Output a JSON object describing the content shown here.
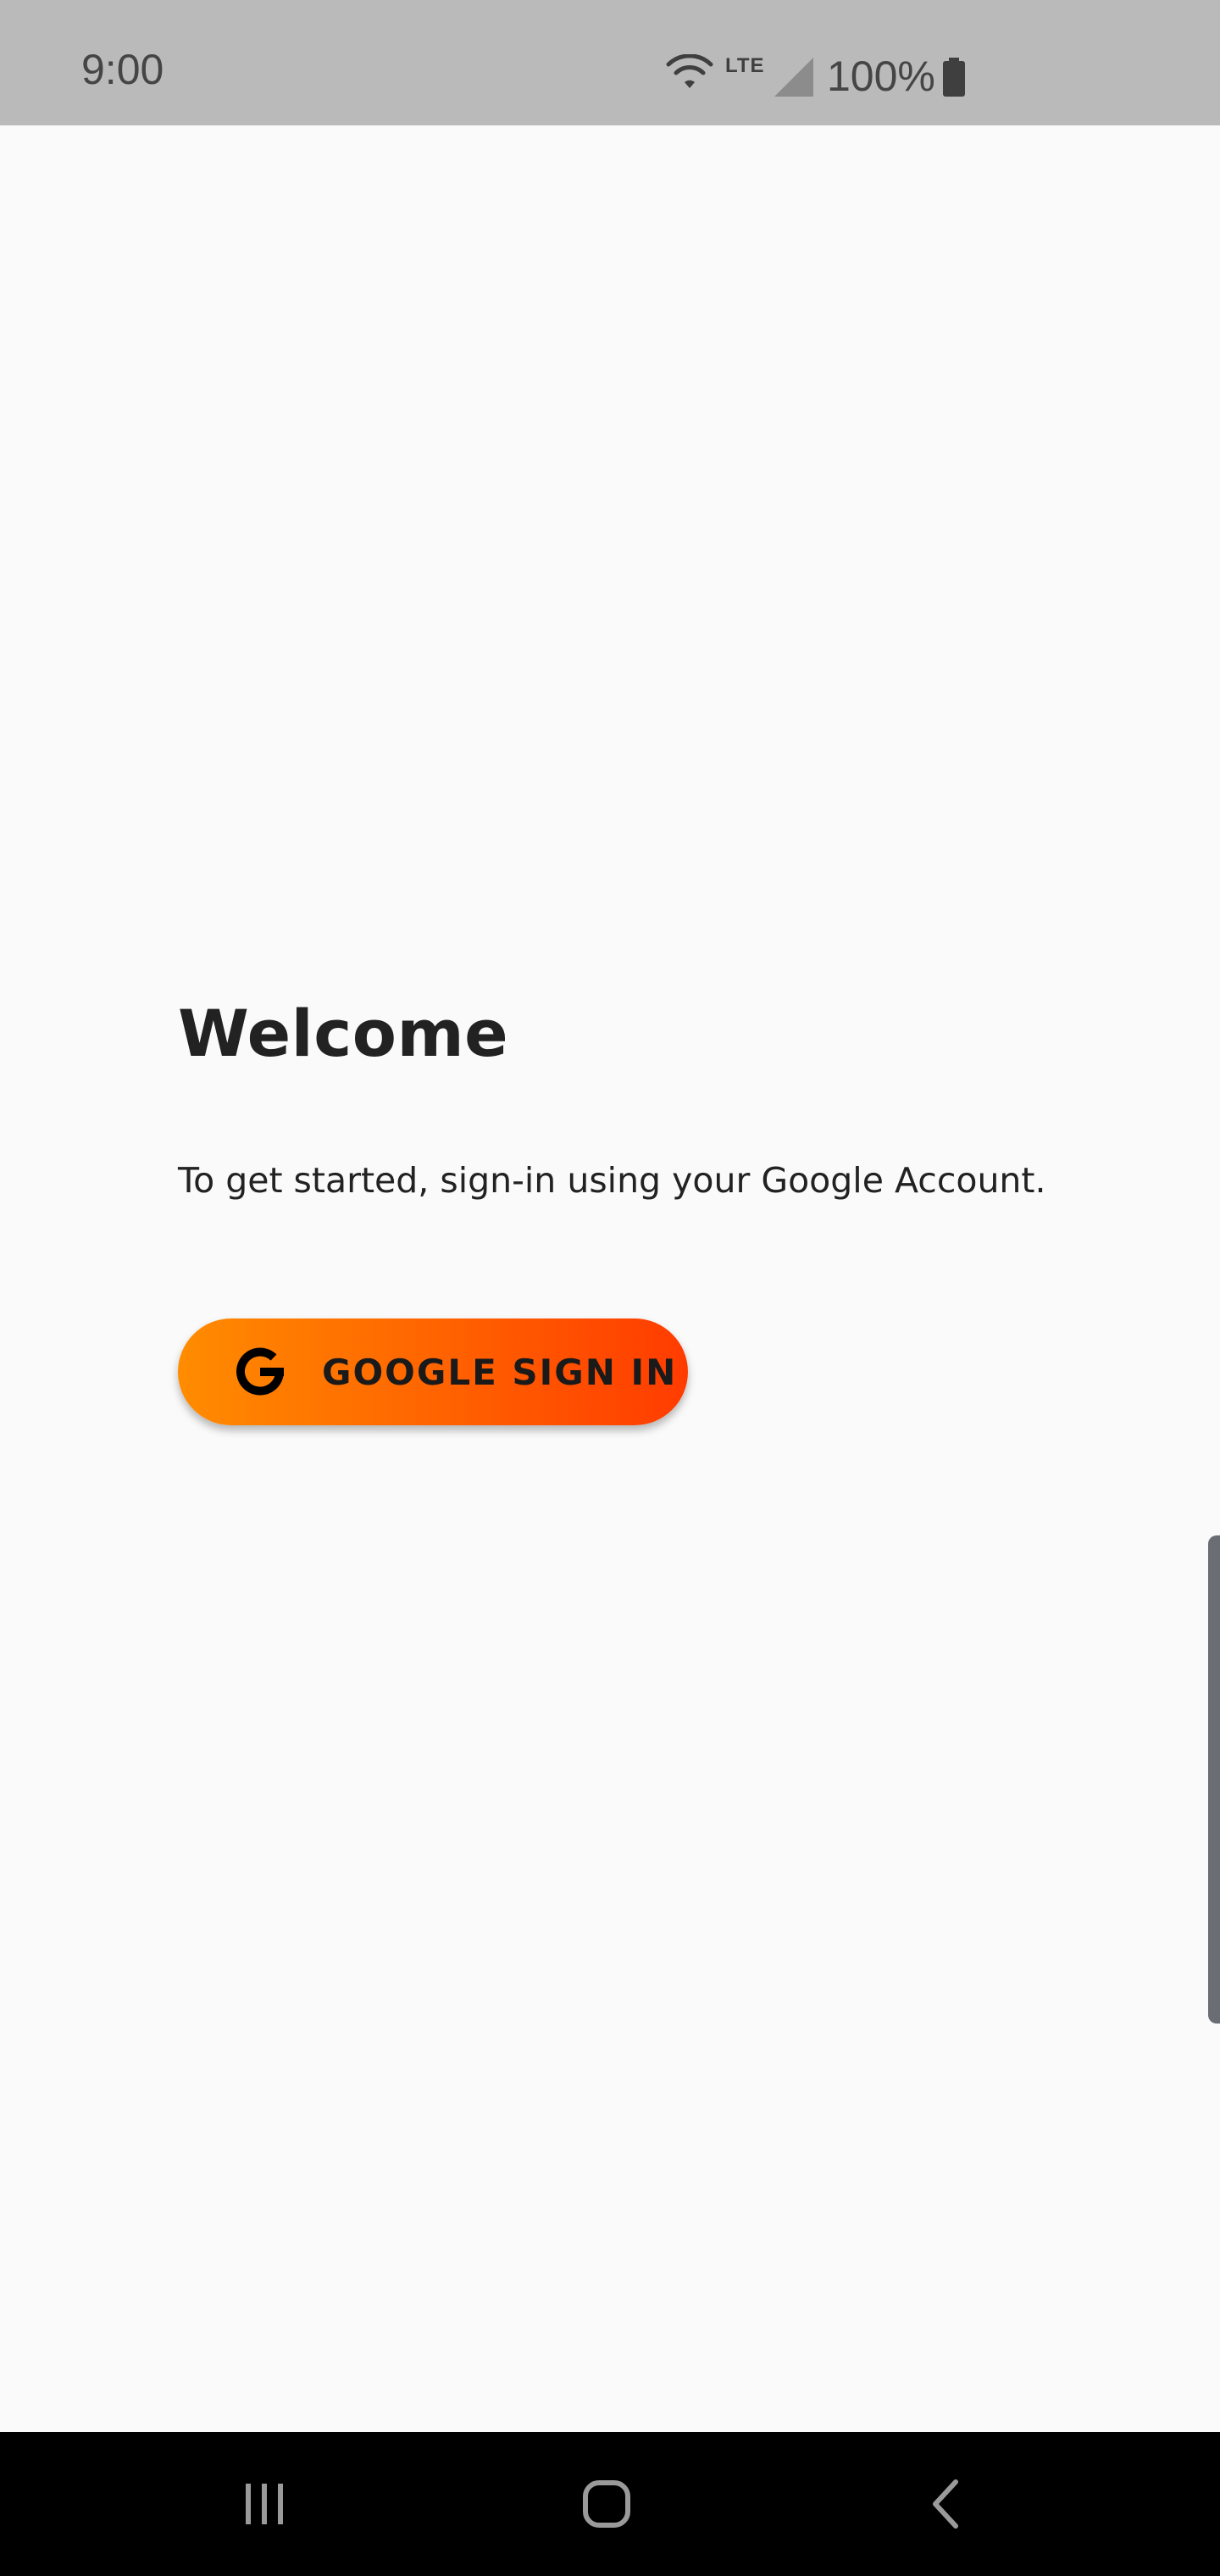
{
  "status_bar": {
    "time": "9:00",
    "network_label": "LTE",
    "battery_percent": "100%",
    "icons": [
      "wifi-icon",
      "signal-icon",
      "battery-icon"
    ]
  },
  "main": {
    "title": "Welcome",
    "subtitle": "To get started, sign-in using your Google Account.",
    "signin_button": {
      "label": "GOOGLE SIGN IN",
      "icon": "google-g-icon",
      "gradient_start": "#ff8c00",
      "gradient_end": "#ff3c00"
    }
  },
  "nav_bar": {
    "buttons": [
      "recents-icon",
      "home-icon",
      "back-icon"
    ]
  }
}
